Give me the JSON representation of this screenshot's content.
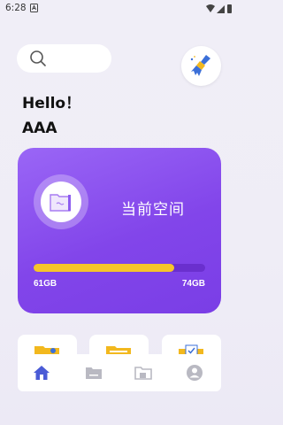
{
  "status_bar": {
    "time": "6:28"
  },
  "search": {
    "placeholder": ""
  },
  "greeting": "Hello！",
  "username": "AAA",
  "storage": {
    "title": "当前空间",
    "used": "61GB",
    "total": "74GB",
    "used_fraction": 0.82
  },
  "colors": {
    "accent": "#8245ea",
    "progress": "#f6c52a",
    "nav_active": "#4a5bd6"
  },
  "quick_actions": [
    {
      "icon": "image-folder-icon"
    },
    {
      "icon": "document-folder-icon"
    },
    {
      "icon": "checklist-folder-icon"
    }
  ],
  "bottom_nav": [
    {
      "icon": "home-icon",
      "active": true
    },
    {
      "icon": "folder-icon",
      "active": false
    },
    {
      "icon": "open-folder-icon",
      "active": false
    },
    {
      "icon": "profile-icon",
      "active": false
    }
  ]
}
